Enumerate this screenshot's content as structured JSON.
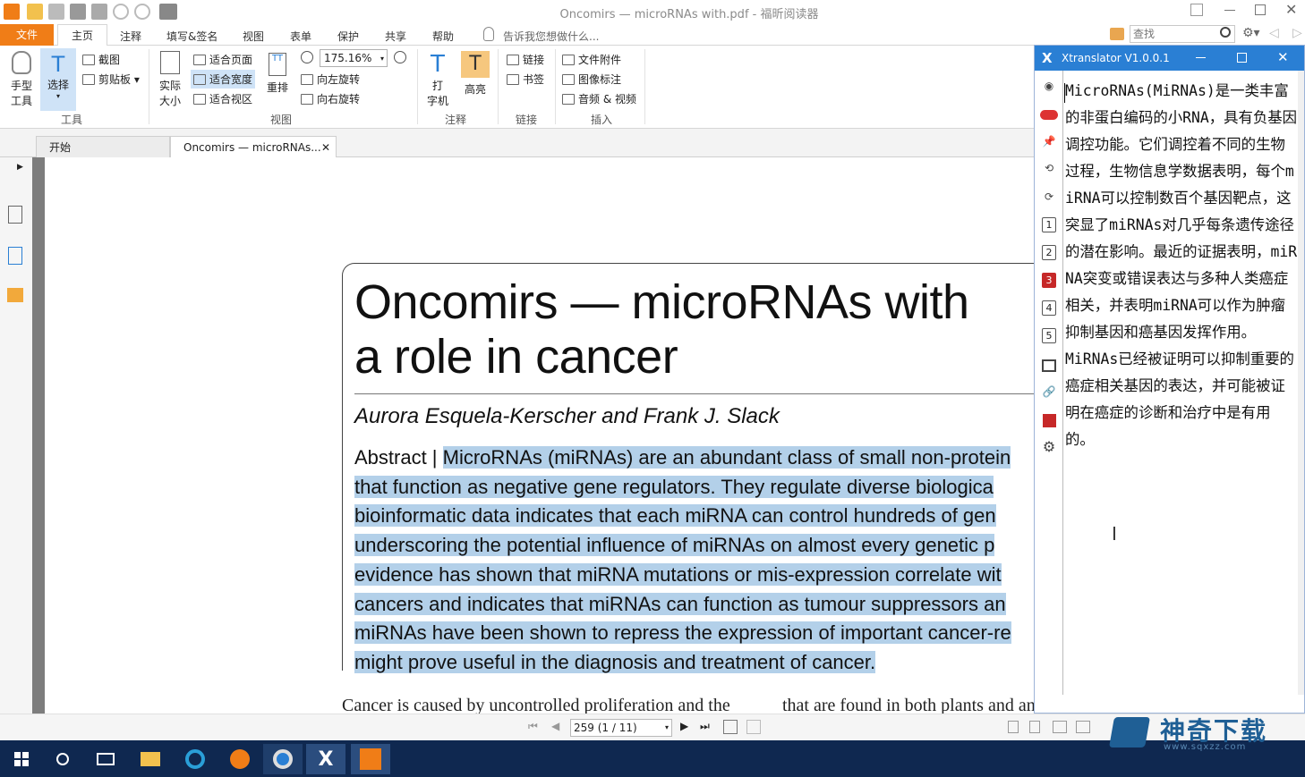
{
  "window": {
    "title": "Oncomirs — microRNAs with.pdf - 福昕阅读器"
  },
  "menu": {
    "items": [
      "文件",
      "主页",
      "注释",
      "填写&签名",
      "视图",
      "表单",
      "保护",
      "共享",
      "帮助"
    ],
    "tell_me": "告诉我您想做什么...",
    "search_placeholder": "查找"
  },
  "ribbon": {
    "hand_tool": [
      "手型",
      "工具"
    ],
    "select": "选择",
    "screenshot": "截图",
    "clipboard": "剪贴板",
    "tools_group": "工具",
    "actual_size": [
      "实际",
      "大小"
    ],
    "fit_page": "适合页面",
    "fit_width": "适合宽度",
    "fit_view": "适合视区",
    "reflow": "重排",
    "zoom": "175.16%",
    "rotate_left": "向左旋转",
    "rotate_right": "向右旋转",
    "view_group": "视图",
    "typewriter": [
      "打",
      "字机"
    ],
    "highlight": "高亮",
    "annotate_group": "注释",
    "link": "链接",
    "bookmark": "书签",
    "link_group": "链接",
    "file_attachment": "文件附件",
    "image_annotation": "图像标注",
    "audio_video": "音频 & 视频",
    "insert_group": "插入"
  },
  "tabs": [
    {
      "label": "开始"
    },
    {
      "label": "Oncomirs — microRNAs..."
    }
  ],
  "document": {
    "title_line1": "Oncomirs — microRNAs with",
    "title_line2": "a role in cancer",
    "authors": "Aurora Esquela-Kerscher and Frank J. Slack",
    "abstract_label": "Abstract | ",
    "abstract_lines": [
      "MicroRNAs (miRNAs) are an abundant class of small non-protein",
      "that function as negative gene regulators. They regulate diverse biologica",
      "bioinformatic data indicates that each miRNA can control hundreds of gen",
      "underscoring the potential influence of miRNAs on almost every genetic p",
      "evidence has shown that miRNA mutations or mis-expression correlate wit",
      "cancers and indicates that miRNAs can function as tumour suppressors an",
      "miRNAs have been shown to repress the expression of important cancer-re",
      "might prove useful in the diagnosis and treatment of cancer."
    ],
    "body_left": "Cancer is caused by uncontrolled proliferation and the",
    "body_right": "that are found in both plants and animals"
  },
  "navigation": {
    "page_display": "259 (1 / 11)"
  },
  "translator": {
    "title": "Xtranslator V1.0.0.1",
    "side_numbers": [
      "1",
      "2",
      "3",
      "4",
      "5"
    ],
    "translation_p1": "MicroRNAs(MiRNAs)是一类丰富的非蛋白编码的小RNA，具有负基因调控功能。它们调控着不同的生物过程，生物信息学数据表明，每个miRNA可以控制数百个基因靶点，这突显了miRNAs对几乎每条遗传途径的潜在影响。最近的证据表明，miRNA突变或错误表达与多种人类癌症相关，并表明miRNA可以作为肿瘤抑制基因和癌基因发挥作用。",
    "translation_p2": "MiRNAs已经被证明可以抑制重要的癌症相关基因的表达，并可能被证明在癌症的诊断和治疗中是有用的。"
  },
  "watermark": {
    "text": "神奇下载",
    "url": "www.sqxzz.com"
  },
  "colors": {
    "accent_orange": "#f07d17",
    "translator_blue": "#2a7fd4",
    "highlight_blue": "#b3d0e9",
    "taskbar": "#0f2850"
  }
}
